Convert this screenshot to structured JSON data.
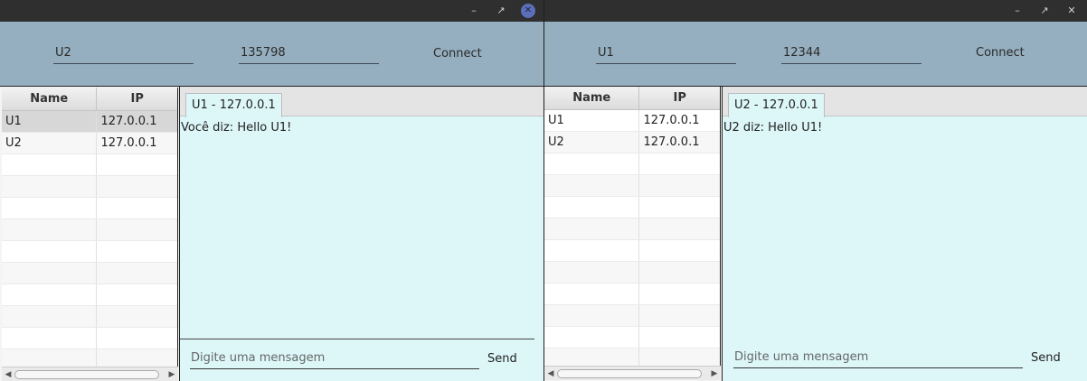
{
  "windows": {
    "left": {
      "titlebar": {
        "minimize_icon": "minimize-icon",
        "maximize_icon": "maximize-icon",
        "close_icon": "close-icon"
      },
      "connection": {
        "user_value": "U2",
        "port_value": "135798",
        "connect_label": "Connect"
      },
      "users_table": {
        "columns": [
          "Name",
          "IP"
        ],
        "rows": [
          {
            "name": "U1",
            "ip": "127.0.0.1",
            "selected": true
          },
          {
            "name": "U2",
            "ip": "127.0.0.1",
            "selected": false
          }
        ]
      },
      "chat": {
        "tab_label": "U1 - 127.0.0.1",
        "messages": [
          "Você diz: Hello U1!"
        ],
        "input_placeholder": "Digite uma mensagem",
        "send_label": "Send"
      }
    },
    "right": {
      "titlebar": {
        "minimize_icon": "minimize-icon",
        "maximize_icon": "maximize-icon",
        "close_icon": "close-icon"
      },
      "connection": {
        "user_value": "U1",
        "port_value": "12344",
        "connect_label": "Connect"
      },
      "users_table": {
        "columns": [
          "Name",
          "IP"
        ],
        "rows": [
          {
            "name": "U1",
            "ip": "127.0.0.1",
            "selected": false
          },
          {
            "name": "U2",
            "ip": "127.0.0.1",
            "selected": false
          }
        ]
      },
      "chat": {
        "tab_label": "U2 - 127.0.0.1",
        "messages": [
          "U2 diz: Hello U1!"
        ],
        "input_placeholder": "Digite uma mensagem",
        "send_label": "Send"
      }
    }
  },
  "colors": {
    "header": "#95afc0",
    "chat_bg": "#ddf7f9",
    "titlebar": "#2f2f2f",
    "close_btn": "#5a6fb8"
  }
}
